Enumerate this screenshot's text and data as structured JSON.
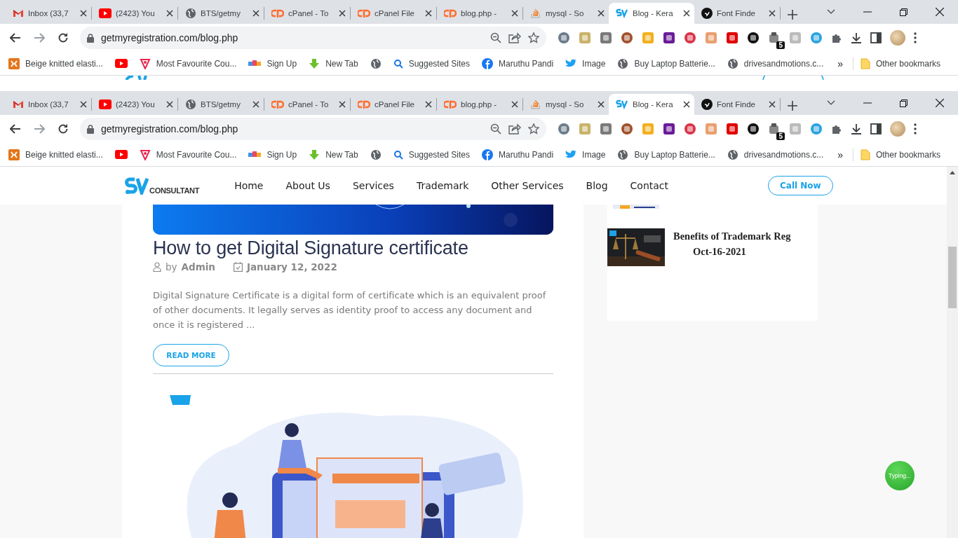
{
  "browser_frames": [
    {
      "tabs": [
        {
          "title": "Inbox (33,7",
          "selected": false
        },
        {
          "title": "(2423) You",
          "selected": false
        },
        {
          "title": "BTS/getmy",
          "selected": false
        },
        {
          "title": "cPanel - To",
          "selected": false
        },
        {
          "title": "cPanel File",
          "selected": false
        },
        {
          "title": "blog.php -",
          "selected": false
        },
        {
          "title": "mysql - So",
          "selected": false
        },
        {
          "title": "Blog - Kera",
          "selected": true
        },
        {
          "title": "Font Finde",
          "selected": false
        }
      ],
      "address": "getmyregistration.com/blog.php",
      "extension_badge": "5",
      "bookmarks": [
        "Beige knitted elasti...",
        "Most Favourite Cou...",
        "Sign Up",
        "New Tab",
        "Suggested Sites",
        "Maruthu Pandi",
        "Image",
        "Buy Laptop Batterie...",
        "drivesandmotions.c..."
      ],
      "more_bookmarks": "»",
      "other_bookmarks": "Other bookmarks"
    },
    {
      "tabs": [
        {
          "title": "Inbox (33,7",
          "selected": false
        },
        {
          "title": "(2423) You",
          "selected": false
        },
        {
          "title": "BTS/getmy",
          "selected": false
        },
        {
          "title": "cPanel - To",
          "selected": false
        },
        {
          "title": "cPanel File",
          "selected": false
        },
        {
          "title": "blog.php -",
          "selected": false
        },
        {
          "title": "mysql - So",
          "selected": false
        },
        {
          "title": "Blog - Kera",
          "selected": true
        },
        {
          "title": "Font Finde",
          "selected": false
        }
      ],
      "address": "getmyregistration.com/blog.php",
      "extension_badge": "5",
      "bookmarks": [
        "Beige knitted elasti...",
        "Most Favourite Cou...",
        "Sign Up",
        "New Tab",
        "Suggested Sites",
        "Maruthu Pandi",
        "Image",
        "Buy Laptop Batterie...",
        "drivesandmotions.c..."
      ],
      "more_bookmarks": "»",
      "other_bookmarks": "Other bookmarks"
    }
  ],
  "site_header": {
    "logo_text": "CONSULTANT",
    "nav": [
      {
        "label": "Home",
        "selected": false
      },
      {
        "label": "About Us",
        "selected": false
      },
      {
        "label": "Services",
        "selected": false
      },
      {
        "label": "Trademark",
        "selected": false
      },
      {
        "label": "Other Services",
        "selected": false
      },
      {
        "label": "Blog",
        "selected": false
      },
      {
        "label": "Contact",
        "selected": false
      }
    ],
    "call_button": "Call Now"
  },
  "post": {
    "title": "How to get Digital Signature certificate",
    "author_prefix": "by",
    "author": "Admin",
    "date": "January 12, 2022",
    "excerpt": "Digital Signature Certificate is a digital form of certificate which is an equivalent proof of other documents. It legally serves as identity proof to access any document and once it is registered ...",
    "read_more": "READ MORE"
  },
  "sidebar": {
    "recent_posts": [
      {
        "title": "Benefits of Trademark Reg",
        "date": "Oct-16-2021"
      }
    ]
  },
  "chat_bubble": {
    "label": "Typing..."
  }
}
